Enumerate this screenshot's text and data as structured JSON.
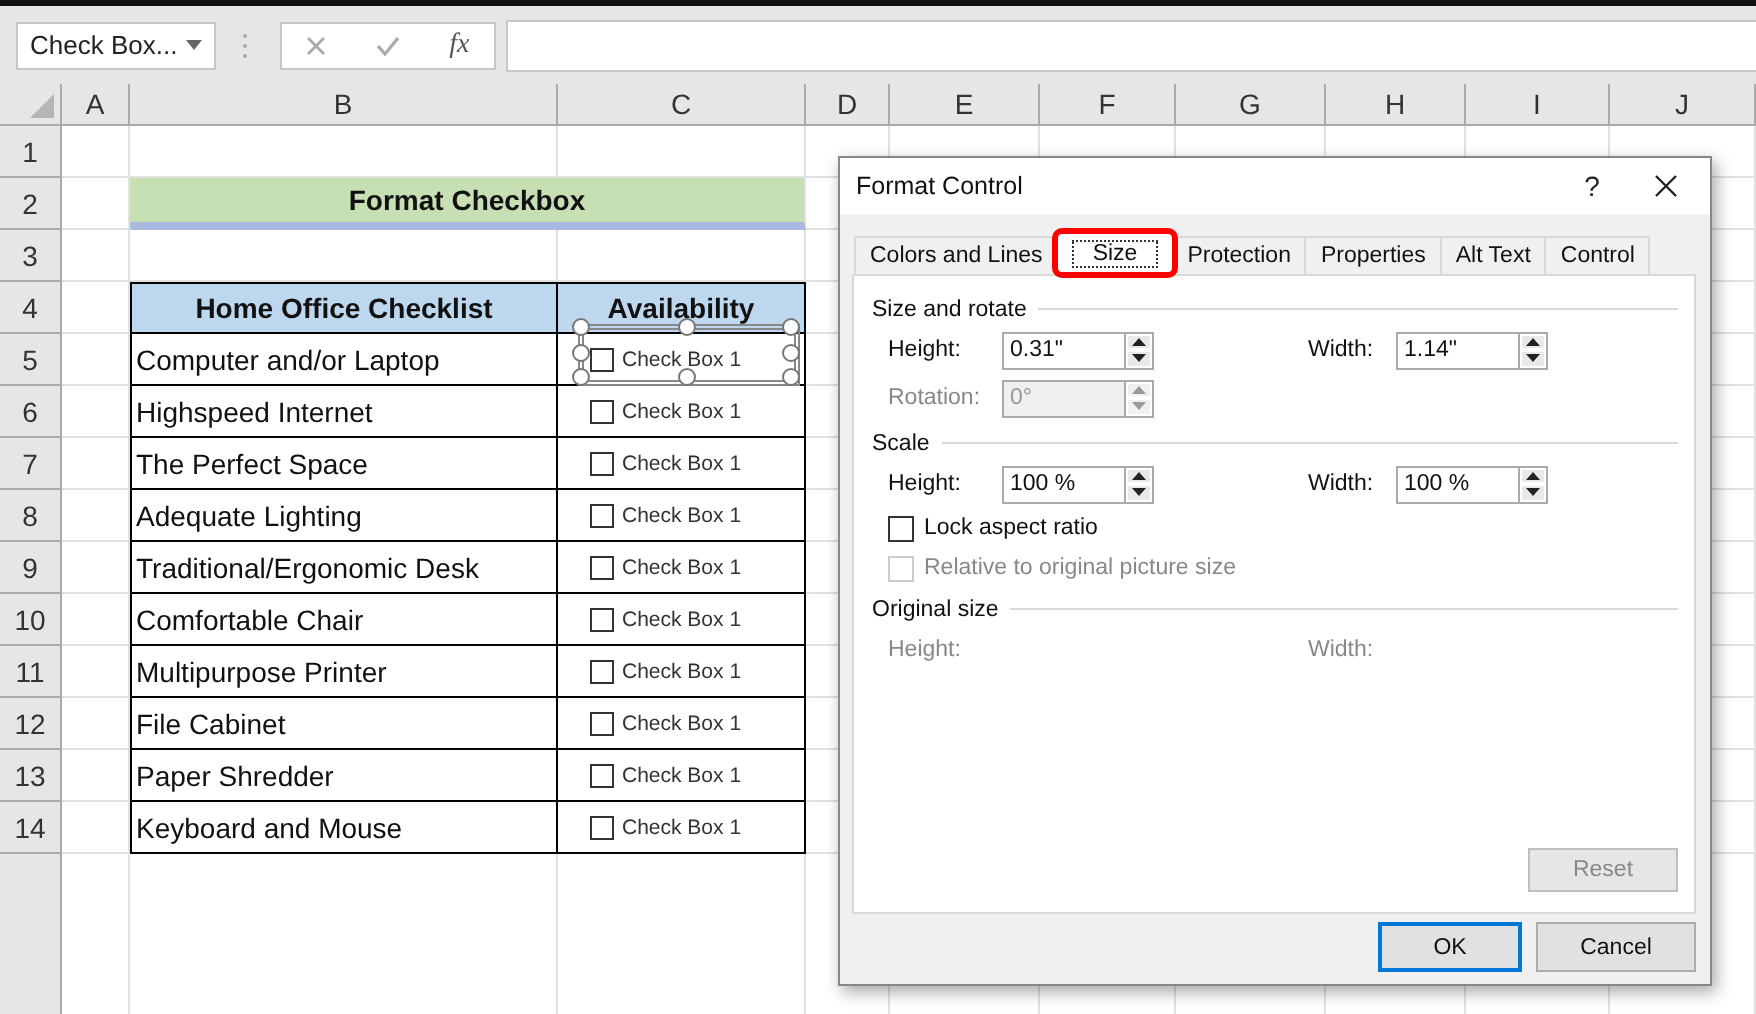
{
  "name_box": {
    "value": "Check Box..."
  },
  "formula_bar": {
    "function_label": "fx"
  },
  "column_headers": [
    "A",
    "B",
    "C",
    "D",
    "E",
    "F",
    "G",
    "H",
    "I",
    "J"
  ],
  "row_headers": [
    "1",
    "2",
    "3",
    "4",
    "5",
    "6",
    "7",
    "8",
    "9",
    "10",
    "11",
    "12",
    "13",
    "14"
  ],
  "sheet_title": "Format Checkbox",
  "table": {
    "columns": [
      "Home Office Checklist",
      "Availability"
    ],
    "rows": [
      {
        "item": "Computer and/or Laptop",
        "checkbox": {
          "label": "Check Box 1",
          "checked": false,
          "selected": true
        }
      },
      {
        "item": "Highspeed Internet",
        "checkbox": {
          "label": "Check Box 1",
          "checked": false,
          "selected": false
        }
      },
      {
        "item": "The Perfect Space",
        "checkbox": {
          "label": "Check Box 1",
          "checked": false,
          "selected": false
        }
      },
      {
        "item": "Adequate Lighting",
        "checkbox": {
          "label": "Check Box 1",
          "checked": false,
          "selected": false
        }
      },
      {
        "item": "Traditional/Ergonomic Desk",
        "checkbox": {
          "label": "Check Box 1",
          "checked": false,
          "selected": false
        }
      },
      {
        "item": "Comfortable Chair",
        "checkbox": {
          "label": "Check Box 1",
          "checked": false,
          "selected": false
        }
      },
      {
        "item": "Multipurpose Printer",
        "checkbox": {
          "label": "Check Box 1",
          "checked": false,
          "selected": false
        }
      },
      {
        "item": "File Cabinet",
        "checkbox": {
          "label": "Check Box 1",
          "checked": false,
          "selected": false
        }
      },
      {
        "item": "Paper Shredder",
        "checkbox": {
          "label": "Check Box 1",
          "checked": false,
          "selected": false
        }
      },
      {
        "item": "Keyboard and Mouse",
        "checkbox": {
          "label": "Check Box 1",
          "checked": false,
          "selected": false
        }
      }
    ]
  },
  "dialog": {
    "title": "Format Control",
    "help": "?",
    "tabs": [
      {
        "label": "Colors and Lines",
        "selected": false,
        "highlighted": false
      },
      {
        "label": "Size",
        "selected": true,
        "highlighted": true
      },
      {
        "label": "Protection",
        "selected": false,
        "highlighted": false
      },
      {
        "label": "Properties",
        "selected": false,
        "highlighted": false
      },
      {
        "label": "Alt Text",
        "selected": false,
        "highlighted": false
      },
      {
        "label": "Control",
        "selected": false,
        "highlighted": false
      }
    ],
    "sections": [
      {
        "title": "Size and rotate",
        "rows": [
          [
            {
              "label": "Height:",
              "value": "0.31\"",
              "disabled": false
            },
            {
              "label": "Width:",
              "value": "1.14\"",
              "disabled": false
            }
          ],
          [
            {
              "label": "Rotation:",
              "value": "0°",
              "disabled": true
            }
          ]
        ]
      },
      {
        "title": "Scale",
        "rows": [
          [
            {
              "label": "Height:",
              "value": "100 %",
              "disabled": false
            },
            {
              "label": "Width:",
              "value": "100 %",
              "disabled": false
            }
          ]
        ],
        "options": [
          {
            "label": "Lock aspect ratio",
            "checked": false,
            "disabled": false
          },
          {
            "label": "Relative to original picture size",
            "checked": false,
            "disabled": true
          }
        ]
      },
      {
        "title": "Original size",
        "rows": [
          [
            {
              "label": "Height:",
              "disabled": true
            },
            {
              "label": "Width:",
              "disabled": true
            }
          ]
        ]
      }
    ],
    "reset": {
      "label": "Reset",
      "disabled": true
    },
    "buttons": [
      {
        "label": "OK",
        "default": true
      },
      {
        "label": "Cancel",
        "default": false
      }
    ]
  }
}
